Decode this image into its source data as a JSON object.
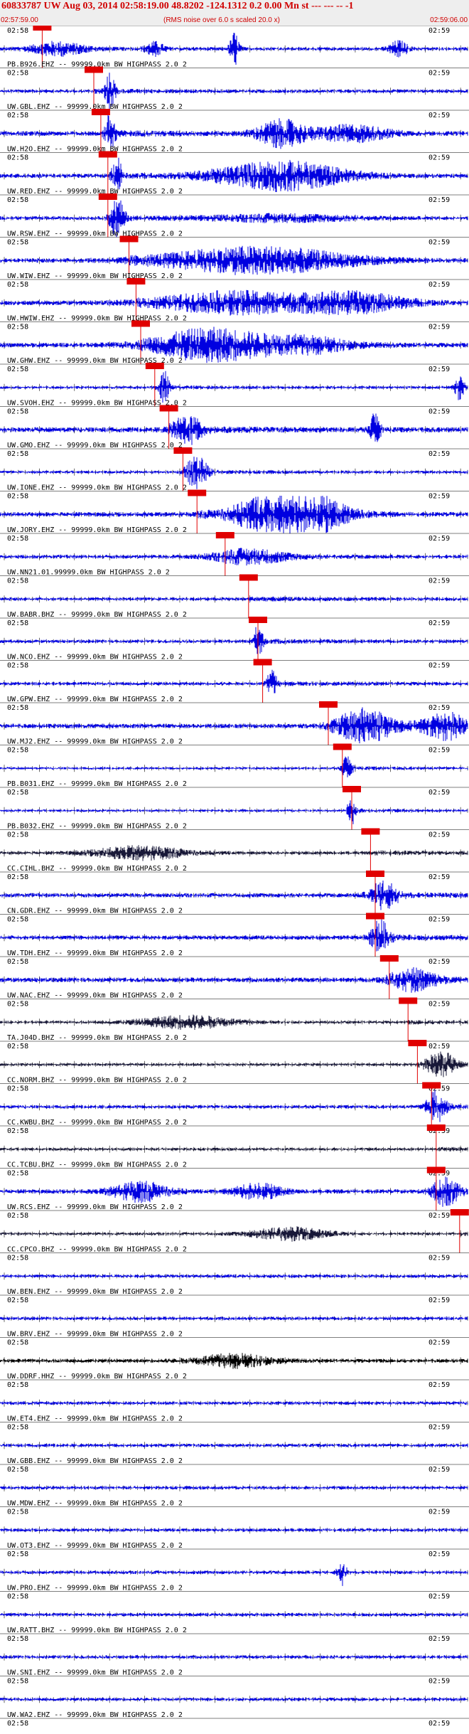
{
  "header": {
    "title": "60833787 UW Aug 03, 2014 02:58:19.00   48.8202 -124.1312  0.2 0.00 Mn st --- --- --  -1",
    "scale_note": "(RMS noise over 6.0 s scaled 20.0 x)",
    "start_time": "02:57:59.00",
    "end_time": "02:59:06.00"
  },
  "colors": {
    "trace_primary": "#0000e0",
    "trace_dark": "#181838",
    "trace_black": "#000000",
    "pick": "#e00000",
    "header_bg": "#eeeeee",
    "title": "#d00000"
  },
  "chart_data": {
    "type": "seismogram",
    "time_start": "02:57:59.00",
    "time_end": "02:59:06.00",
    "origin_time": "02:58:19.00",
    "tick_labels": [
      "02:58",
      "02:59"
    ],
    "stations": [
      {
        "label": "",
        "pick": 0.09,
        "amp": 0.4,
        "color": "#0000e0",
        "bursts": [
          [
            0.12,
            0.06,
            0.9
          ],
          [
            0.5,
            0.01,
            2.5
          ],
          [
            0.33,
            0.02,
            1.0
          ],
          [
            0.85,
            0.02,
            1.2
          ]
        ]
      },
      {
        "label": "PB.B926.EHZ -- 99999.0km BW  HIGHPASS  2.0  2",
        "pick": 0.2,
        "amp": 0.4,
        "color": "#0000e0",
        "bursts": [
          [
            0.235,
            0.01,
            3.0
          ]
        ]
      },
      {
        "label": "UW.GBL.EHZ -- 99999.0km BW  HIGHPASS  2.0  2",
        "pick": 0.215,
        "amp": 0.55,
        "color": "#0000e0",
        "bursts": [
          [
            0.235,
            0.01,
            3.0
          ],
          [
            0.6,
            0.05,
            2.0
          ],
          [
            0.75,
            0.08,
            1.2
          ]
        ]
      },
      {
        "label": "UW.H2O.EHZ -- 99999.0km BW  HIGHPASS  2.0  2",
        "pick": 0.23,
        "amp": 0.5,
        "color": "#0000e0",
        "bursts": [
          [
            0.25,
            0.01,
            3.0
          ],
          [
            0.6,
            0.14,
            2.2
          ]
        ]
      },
      {
        "label": "UW.RED.EHZ -- 99999.0km BW  HIGHPASS  2.0  2",
        "pick": 0.23,
        "amp": 0.45,
        "color": "#0000e0",
        "bursts": [
          [
            0.25,
            0.015,
            3.0
          ],
          [
            0.6,
            0.15,
            0.5
          ]
        ]
      },
      {
        "label": "UW.RSW.EHZ -- 99999.0km BW  HIGHPASS  2.0  2",
        "pick": 0.275,
        "amp": 0.5,
        "color": "#0000e0",
        "bursts": [
          [
            0.55,
            0.2,
            2.0
          ]
        ]
      },
      {
        "label": "UW.WIW.EHZ -- 99999.0km BW  HIGHPASS  2.0  2",
        "pick": 0.29,
        "amp": 0.55,
        "color": "#0000e0",
        "bursts": [
          [
            0.5,
            0.15,
            1.6
          ],
          [
            0.75,
            0.12,
            1.5
          ]
        ]
      },
      {
        "label": "UW.HWIW.EHZ -- 99999.0km BW  HIGHPASS  2.0  2",
        "pick": 0.3,
        "amp": 0.55,
        "color": "#0000e0",
        "bursts": [
          [
            0.45,
            0.12,
            2.4
          ],
          [
            0.65,
            0.1,
            1.2
          ]
        ]
      },
      {
        "label": "UW.GHW.EHZ -- 99999.0km BW  HIGHPASS  2.0  2",
        "pick": 0.33,
        "amp": 0.35,
        "color": "#0000e0",
        "bursts": [
          [
            0.35,
            0.01,
            2.5
          ],
          [
            0.98,
            0.01,
            2.0
          ]
        ]
      },
      {
        "label": "UW.SVOH.EHZ -- 99999.0km BW  HIGHPASS  2.0  2",
        "pick": 0.36,
        "amp": 0.6,
        "color": "#0000e0",
        "bursts": [
          [
            0.4,
            0.03,
            2.0
          ],
          [
            0.8,
            0.01,
            3.0
          ]
        ]
      },
      {
        "label": "UW.GMO.EHZ -- 99999.0km BW  HIGHPASS  2.0  2",
        "pick": 0.39,
        "amp": 0.35,
        "color": "#0000e0",
        "bursts": [
          [
            0.42,
            0.02,
            3.0
          ]
        ]
      },
      {
        "label": "UW.IONE.EHZ -- 99999.0km BW  HIGHPASS  2.0  2",
        "pick": 0.42,
        "amp": 0.55,
        "color": "#0000e0",
        "bursts": [
          [
            0.62,
            0.1,
            4.5
          ]
        ]
      },
      {
        "label": "UW.JORY.EHZ -- 99999.0km BW  HIGHPASS  2.0  2",
        "pick": 0.48,
        "amp": 0.45,
        "color": "#0000e0",
        "bursts": [
          [
            0.53,
            0.08,
            1.0
          ]
        ]
      },
      {
        "label": "UW.NN21.01.99999.0km BW  HIGHPASS  2.0  2",
        "pick": 0.53,
        "amp": 0.4,
        "color": "#0000e0",
        "bursts": []
      },
      {
        "label": "UW.BABR.BHZ -- 99999.0km BW  HIGHPASS  2.0  2",
        "pick": 0.55,
        "amp": 0.4,
        "color": "#0000e0",
        "bursts": [
          [
            0.55,
            0.01,
            2.5
          ]
        ]
      },
      {
        "label": "UW.NCO.EHZ -- 99999.0km BW  HIGHPASS  2.0  2",
        "pick": 0.56,
        "amp": 0.4,
        "color": "#0000e0",
        "bursts": [
          [
            0.58,
            0.01,
            2.0
          ]
        ]
      },
      {
        "label": "UW.GPW.EHZ -- 99999.0km BW  HIGHPASS  2.0  2",
        "pick": 0.7,
        "amp": 0.55,
        "color": "#0000e0",
        "bursts": [
          [
            0.78,
            0.06,
            2.5
          ],
          [
            0.95,
            0.05,
            2.0
          ]
        ]
      },
      {
        "label": "UW.MJ2.EHZ -- 99999.0km BW  HIGHPASS  2.0  2",
        "pick": 0.73,
        "amp": 0.3,
        "color": "#0000e0",
        "bursts": [
          [
            0.74,
            0.01,
            2.0
          ]
        ]
      },
      {
        "label": "PB.B031.EHZ -- 99999.0km BW  HIGHPASS  2.0  2",
        "pick": 0.75,
        "amp": 0.3,
        "color": "#0000e0",
        "bursts": [
          [
            0.75,
            0.01,
            2.0
          ]
        ]
      },
      {
        "label": "PB.B032.EHZ -- 99999.0km BW  HIGHPASS  2.0  2",
        "pick": 0.79,
        "amp": 0.4,
        "color": "#181838",
        "bursts": [
          [
            0.3,
            0.1,
            1.0
          ]
        ]
      },
      {
        "label": "CC.CIHL.BHZ -- 99999.0km BW  HIGHPASS  2.0  2",
        "pick": 0.8,
        "amp": 0.5,
        "color": "#0000e0",
        "bursts": [
          [
            0.82,
            0.03,
            2.0
          ]
        ]
      },
      {
        "label": "CN.GDR.EHZ -- 99999.0km BW  HIGHPASS  2.0  2",
        "pick": 0.8,
        "amp": 0.5,
        "color": "#0000e0",
        "bursts": [
          [
            0.81,
            0.02,
            2.5
          ]
        ]
      },
      {
        "label": "UW.TDH.EHZ -- 99999.0km BW  HIGHPASS  2.0  2",
        "pick": 0.83,
        "amp": 0.55,
        "color": "#0000e0",
        "bursts": [
          [
            0.88,
            0.05,
            1.5
          ]
        ]
      },
      {
        "label": "UW.NAC.EHZ -- 99999.0km BW  HIGHPASS  2.0  2",
        "pick": 0.87,
        "amp": 0.35,
        "color": "#181838",
        "bursts": [
          [
            0.4,
            0.1,
            1.0
          ]
        ]
      },
      {
        "label": "TA.J04D.BHZ -- 99999.0km BW  HIGHPASS  2.0  2",
        "pick": 0.89,
        "amp": 0.35,
        "color": "#181838",
        "bursts": [
          [
            0.94,
            0.03,
            2.0
          ]
        ]
      },
      {
        "label": "CC.NORM.BHZ -- 99999.0km BW  HIGHPASS  2.0  2",
        "pick": 0.92,
        "amp": 0.4,
        "color": "#0000e0",
        "bursts": [
          [
            0.93,
            0.02,
            2.5
          ]
        ]
      },
      {
        "label": "CC.KWBU.BHZ -- 99999.0km BW  HIGHPASS  2.0  2",
        "pick": 0.93,
        "amp": 0.35,
        "color": "#181838",
        "bursts": []
      },
      {
        "label": "CC.TCBU.BHZ -- 99999.0km BW  HIGHPASS  2.0  2",
        "pick": 0.93,
        "amp": 0.5,
        "color": "#0000e0",
        "bursts": [
          [
            0.3,
            0.06,
            1.5
          ],
          [
            0.55,
            0.05,
            1.2
          ],
          [
            0.95,
            0.03,
            2.0
          ]
        ]
      },
      {
        "label": "UW.RCS.EHZ -- 99999.0km BW  HIGHPASS  2.0  2",
        "pick": 0.98,
        "amp": 0.35,
        "color": "#181838",
        "bursts": [
          [
            0.62,
            0.08,
            1.0
          ]
        ]
      },
      {
        "label": "CC.CPCO.BHZ -- 99999.0km BW  HIGHPASS  2.0  2",
        "pick": null,
        "amp": 0.4,
        "color": "#0000e0",
        "bursts": []
      },
      {
        "label": "UW.BEN.EHZ -- 99999.0km BW  HIGHPASS  2.0  2",
        "pick": null,
        "amp": 0.4,
        "color": "#0000e0",
        "bursts": []
      },
      {
        "label": "UW.BRV.EHZ -- 99999.0km BW  HIGHPASS  2.0  2",
        "pick": null,
        "amp": 0.45,
        "color": "#000000",
        "bursts": [
          [
            0.5,
            0.08,
            1.0
          ]
        ]
      },
      {
        "label": "UW.DDRF.HHZ -- 99999.0km BW  HIGHPASS  2.0  2",
        "pick": null,
        "amp": 0.4,
        "color": "#0000e0",
        "bursts": []
      },
      {
        "label": "UW.ET4.EHZ -- 99999.0km BW  HIGHPASS  2.0  2",
        "pick": null,
        "amp": 0.4,
        "color": "#0000e0",
        "bursts": []
      },
      {
        "label": "UW.GBB.EHZ -- 99999.0km BW  HIGHPASS  2.0  2",
        "pick": null,
        "amp": 0.4,
        "color": "#0000e0",
        "bursts": []
      },
      {
        "label": "UW.MDW.EHZ -- 99999.0km BW  HIGHPASS  2.0  2",
        "pick": null,
        "amp": 0.4,
        "color": "#0000e0",
        "bursts": []
      },
      {
        "label": "UW.OT3.EHZ -- 99999.0km BW  HIGHPASS  2.0  2",
        "pick": null,
        "amp": 0.4,
        "color": "#0000e0",
        "bursts": [
          [
            0.73,
            0.01,
            2.0
          ]
        ]
      },
      {
        "label": "UW.PRO.EHZ -- 99999.0km BW  HIGHPASS  2.0  2",
        "pick": null,
        "amp": 0.4,
        "color": "#0000e0",
        "bursts": []
      },
      {
        "label": "UW.RATT.BHZ -- 99999.0km BW  HIGHPASS  2.0  2",
        "pick": null,
        "amp": 0.4,
        "color": "#0000e0",
        "bursts": []
      },
      {
        "label": "UW.SNI.EHZ -- 99999.0km BW  HIGHPASS  2.0  2",
        "pick": null,
        "amp": 0.4,
        "color": "#0000e0",
        "bursts": []
      },
      {
        "label": "UW.WA2.EHZ -- 99999.0km BW  HIGHPASS  2.0  2",
        "pick": null,
        "amp": 0.4,
        "color": "#0000e0",
        "bursts": []
      }
    ]
  }
}
